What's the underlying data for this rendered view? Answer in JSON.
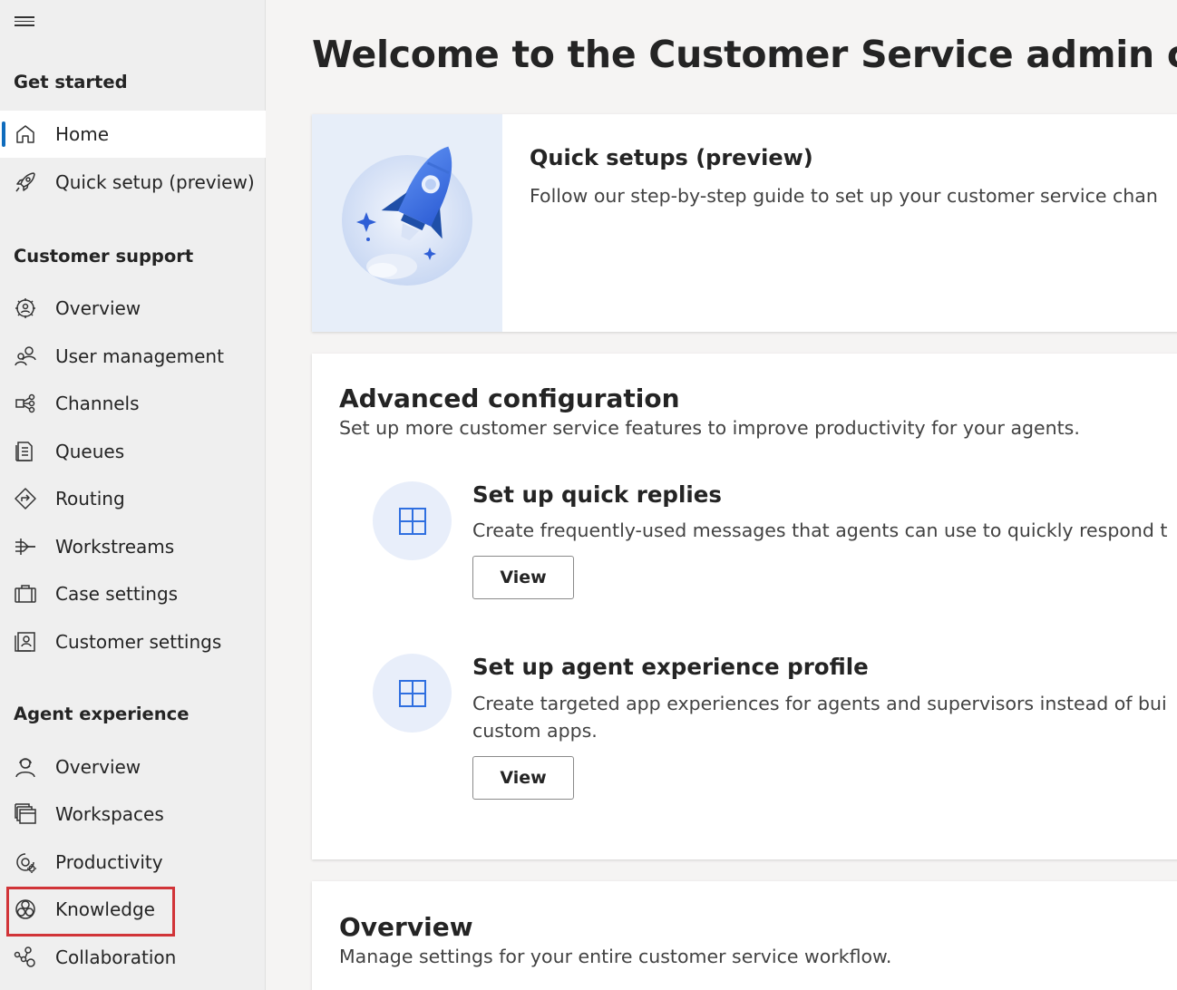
{
  "sidebar": {
    "sections": [
      {
        "title": "Get started",
        "items": [
          {
            "label": "Home",
            "icon": "home-icon"
          },
          {
            "label": "Quick setup (preview)",
            "icon": "rocket-icon"
          }
        ]
      },
      {
        "title": "Customer support",
        "items": [
          {
            "label": "Overview",
            "icon": "gear-people-icon"
          },
          {
            "label": "User management",
            "icon": "people-icon"
          },
          {
            "label": "Channels",
            "icon": "channels-icon"
          },
          {
            "label": "Queues",
            "icon": "queues-icon"
          },
          {
            "label": "Routing",
            "icon": "routing-icon"
          },
          {
            "label": "Workstreams",
            "icon": "workstreams-icon"
          },
          {
            "label": "Case settings",
            "icon": "briefcase-icon"
          },
          {
            "label": "Customer settings",
            "icon": "contact-card-icon"
          }
        ]
      },
      {
        "title": "Agent experience",
        "items": [
          {
            "label": "Overview",
            "icon": "headset-person-icon"
          },
          {
            "label": "Workspaces",
            "icon": "workspaces-icon"
          },
          {
            "label": "Productivity",
            "icon": "productivity-icon"
          },
          {
            "label": "Knowledge",
            "icon": "knowledge-icon"
          },
          {
            "label": "Collaboration",
            "icon": "collaboration-icon"
          }
        ]
      }
    ],
    "active_item": "Home",
    "highlighted_item": "Knowledge"
  },
  "main": {
    "title": "Welcome to the Customer Service admin center",
    "quick_setup": {
      "title": "Quick setups (preview)",
      "description": "Follow our step-by-step guide to set up your customer service chan"
    },
    "advanced": {
      "title": "Advanced configuration",
      "description": "Set up more customer service features to improve productivity for your agents.",
      "features": [
        {
          "title": "Set up quick replies",
          "description_lines": [
            "Create frequently-used messages that agents can use to quickly respond t"
          ],
          "button": "View",
          "icon": "grid-icon"
        },
        {
          "title": "Set up agent experience profile",
          "description_lines": [
            "Create targeted app experiences for agents and supervisors instead of bui",
            "custom apps."
          ],
          "button": "View",
          "icon": "grid-icon"
        }
      ]
    },
    "overview": {
      "title": "Overview",
      "description": "Manage settings for your entire customer service workflow."
    }
  },
  "colors": {
    "accent": "#0f6cbd",
    "highlight": "#d13438",
    "sidebar_bg": "#efefef",
    "page_bg": "#f5f4f3"
  }
}
